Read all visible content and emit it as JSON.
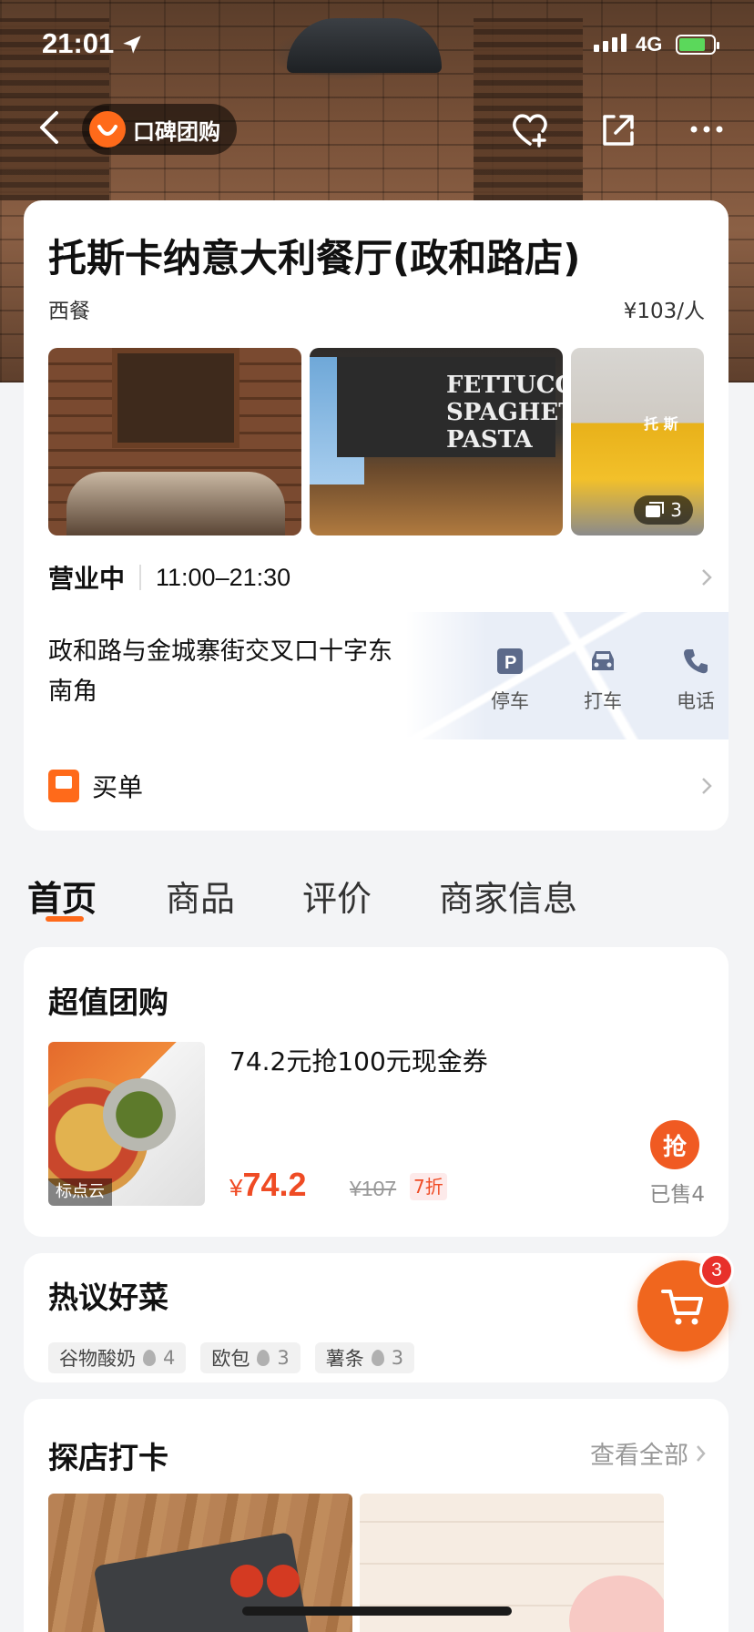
{
  "status_bar": {
    "time": "21:01",
    "network": "4G"
  },
  "nav": {
    "brand_name": "口碑团购"
  },
  "shop": {
    "name": "托斯卡纳意大利餐厅(政和路店)",
    "category": "西餐",
    "avg_price": "¥103/人",
    "photo_count": "3",
    "photo_2_text": "FETTUCCI SPAGHETT PASTA",
    "photo_3_sign": "托 斯",
    "hours_status": "营业中",
    "hours_time": "11:00–21:30",
    "address": "政和路与金城寨街交叉口十字东南角",
    "actions": [
      {
        "label": "停车",
        "icon": "parking-icon"
      },
      {
        "label": "打车",
        "icon": "taxi-icon"
      },
      {
        "label": "电话",
        "icon": "phone-icon"
      }
    ],
    "pay_label": "买单"
  },
  "tabs": [
    {
      "label": "首页",
      "active": true
    },
    {
      "label": "商品",
      "active": false
    },
    {
      "label": "评价",
      "active": false
    },
    {
      "label": "商家信息",
      "active": false
    }
  ],
  "deals": {
    "title": "超值团购",
    "item": {
      "image_watermark": "标点云",
      "name": "74.2元抢100元现金券",
      "currency": "¥",
      "price": "74.2",
      "original_price": "¥107",
      "discount": "7折",
      "grab_label": "抢",
      "sold": "已售4"
    }
  },
  "hot_dishes": {
    "title": "热议好菜",
    "items": [
      {
        "name": "谷物酸奶",
        "count": "4"
      },
      {
        "name": "欧包",
        "count": "3"
      },
      {
        "name": "薯条",
        "count": "3"
      }
    ]
  },
  "cart": {
    "badge": "3"
  },
  "checkin": {
    "title": "探店打卡",
    "view_all": "查看全部"
  },
  "colors": {
    "accent": "#ff6a1a",
    "price_red": "#ef4b24",
    "badge_red": "#e8302a"
  }
}
